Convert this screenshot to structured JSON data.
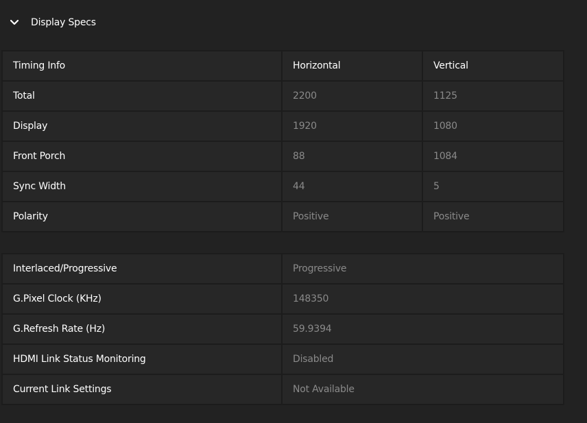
{
  "section": {
    "title": "Display Specs",
    "icon": "chevron-down-icon"
  },
  "timing_table": {
    "headers": [
      "Timing Info",
      "Horizontal",
      "Vertical"
    ],
    "rows": [
      {
        "label": "Total",
        "horizontal": "2200",
        "vertical": "1125"
      },
      {
        "label": "Display",
        "horizontal": "1920",
        "vertical": "1080"
      },
      {
        "label": "Front Porch",
        "horizontal": "88",
        "vertical": "1084"
      },
      {
        "label": "Sync Width",
        "horizontal": "44",
        "vertical": "5"
      },
      {
        "label": "Polarity",
        "horizontal": "Positive",
        "vertical": "Positive"
      }
    ]
  },
  "misc_table": {
    "rows": [
      {
        "label": "Interlaced/Progressive",
        "value": "Progressive"
      },
      {
        "label": "G.Pixel Clock (KHz)",
        "value": "148350"
      },
      {
        "label": "G.Refresh Rate (Hz)",
        "value": "59.9394"
      },
      {
        "label": "HDMI Link Status Monitoring",
        "value": "Disabled"
      },
      {
        "label": "Current Link Settings",
        "value": "Not Available"
      }
    ]
  },
  "colors": {
    "background": "#222222",
    "cell": "#272727",
    "label_text": "#ffffff",
    "value_text": "#8a8a8a"
  }
}
